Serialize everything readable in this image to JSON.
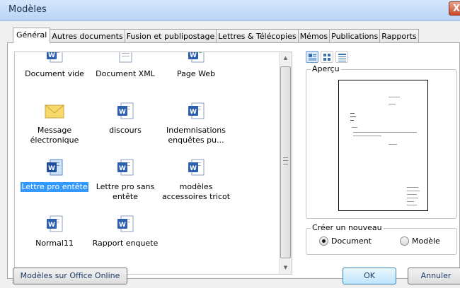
{
  "window": {
    "title": "Modèles",
    "close_label": "X"
  },
  "tabs": [
    {
      "label": "Général",
      "active": true
    },
    {
      "label": "Autres documents"
    },
    {
      "label": "Fusion et publipostage"
    },
    {
      "label": "Lettres & Télécopies"
    },
    {
      "label": "Mémos"
    },
    {
      "label": "Publications"
    },
    {
      "label": "Rapports"
    }
  ],
  "templates": [
    {
      "label": "Document vide",
      "icon": "word-document-icon"
    },
    {
      "label": "Document XML",
      "icon": "xml-document-icon"
    },
    {
      "label": "Page Web",
      "icon": "web-page-icon"
    },
    {
      "label": "Message électronique",
      "icon": "envelope-icon"
    },
    {
      "label": "discours",
      "icon": "word-document-icon"
    },
    {
      "label": "Indemnisations enquêtes pu...",
      "icon": "word-document-icon"
    },
    {
      "label": "Lettre pro entête",
      "icon": "word-document-icon",
      "selected": true
    },
    {
      "label": "Lettre pro sans entête",
      "icon": "word-document-icon"
    },
    {
      "label": "modèles accessoires tricot",
      "icon": "word-document-icon"
    },
    {
      "label": "Normal11",
      "icon": "word-document-icon"
    },
    {
      "label": "Rapport enquete",
      "icon": "word-document-icon"
    }
  ],
  "view_buttons": [
    {
      "icon": "large-icons-view-icon",
      "active": true
    },
    {
      "icon": "list-view-icon"
    },
    {
      "icon": "details-view-icon"
    }
  ],
  "preview": {
    "label": "Aperçu"
  },
  "create_new": {
    "label": "Créer un nouveau",
    "options": [
      {
        "label": "Document",
        "checked": true
      },
      {
        "label": "Modèle",
        "checked": false
      }
    ]
  },
  "buttons": {
    "online": "Modèles sur Office Online",
    "ok": "OK",
    "cancel": "Annuler"
  },
  "colors": {
    "selection": "#3399ff",
    "title_bar": "#c9def7",
    "close_button": "#c84a2a"
  }
}
